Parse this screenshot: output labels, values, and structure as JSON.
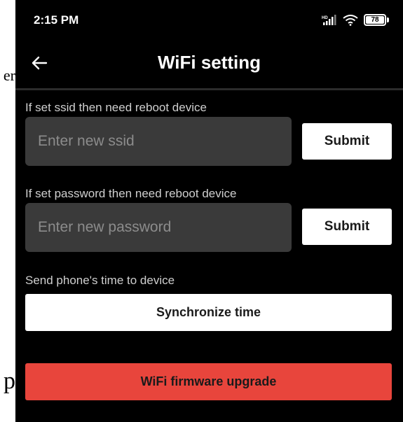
{
  "status_bar": {
    "time": "2:15 PM",
    "battery_level": "78",
    "icons": [
      "hd-signal-icon",
      "wifi-icon",
      "battery-icon"
    ]
  },
  "header": {
    "title": "WiFi setting",
    "back_icon": "arrow-left-icon"
  },
  "ssid_section": {
    "label": "If set ssid then need reboot device",
    "placeholder": "Enter new ssid",
    "value": "",
    "submit_label": "Submit"
  },
  "password_section": {
    "label": "If set password then need reboot device",
    "placeholder": "Enter new password",
    "value": "",
    "submit_label": "Submit"
  },
  "time_section": {
    "label": "Send phone's time to device",
    "button_label": "Synchronize time"
  },
  "firmware": {
    "button_label": "WiFi firmware upgrade"
  },
  "behind_page": {
    "fragment_1": "er",
    "fragment_2": "p"
  },
  "colors": {
    "background": "#000000",
    "input_background": "#3a3a3a",
    "button_background": "#ffffff",
    "upgrade_button": "#e8453c"
  }
}
